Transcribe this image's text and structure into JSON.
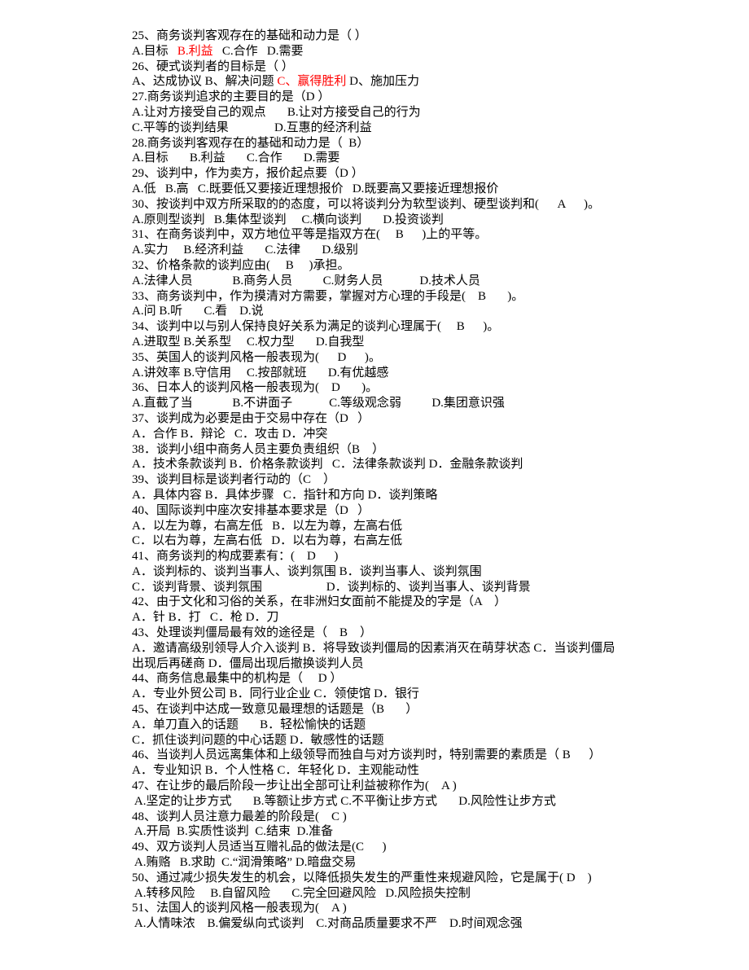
{
  "colors": {
    "text": "#000000",
    "highlight": "#ff0000"
  },
  "lines": [
    [
      {
        "t": "25、商务谈判客观存在的基础和动力是（ ）"
      }
    ],
    [
      {
        "t": "A.目标   "
      },
      {
        "t": "B.利益",
        "red": true
      },
      {
        "t": "   C.合作   D.需要"
      }
    ],
    [
      {
        "t": "26、硬式谈判者的目标是（ ）"
      }
    ],
    [
      {
        "t": "A、达成协议 B、解决问题 "
      },
      {
        "t": "C、赢得胜利",
        "red": true
      },
      {
        "t": " D、施加压力"
      }
    ],
    [
      {
        "t": "27.商务谈判追求的主要目的是（D ）"
      }
    ],
    [
      {
        "t": "A.让对方接受自己的观点       B.让对方接受自己的行为"
      }
    ],
    [
      {
        "t": "C.平等的谈判结果               D.互惠的经济利益"
      }
    ],
    [
      {
        "t": "28.商务谈判客观存在的基础和动力是（  B）"
      }
    ],
    [
      {
        "t": "A.目标       B.利益       C.合作       D.需要"
      }
    ],
    [
      {
        "t": "29、谈判中，作为卖方，报价起点要（D ）"
      }
    ],
    [
      {
        "t": "A.低   B.高   C.既要低又要接近理想报价   D.既要高又要接近理想报价"
      }
    ],
    [
      {
        "t": "30、按谈判中双方所采取的的态度，可以将谈判分为软型谈判、硬型谈判和(      A      )。"
      }
    ],
    [
      {
        "t": "A.原则型谈判   B.集体型谈判     C.横向谈判       D.投资谈判"
      }
    ],
    [
      {
        "t": "31、在商务谈判中，双方地位平等是指双方在(     B      )上的平等。"
      }
    ],
    [
      {
        "t": "A.实力     B.经济利益       C.法律       D.级别"
      }
    ],
    [
      {
        "t": "32、价格条款的谈判应由(     B     )承担。"
      }
    ],
    [
      {
        "t": "A.法律人员             B.商务人员          C.财务人员            D.技术人员"
      }
    ],
    [
      {
        "t": "33、商务谈判中，作为摸清对方需要，掌握对方心理的手段是(    B       )。"
      }
    ],
    [
      {
        "t": "A.问 B.听       C.看    D.说"
      }
    ],
    [
      {
        "t": "34、谈判中以与别人保持良好关系为满足的谈判心理属于(     B      )。"
      }
    ],
    [
      {
        "t": "A.进取型 B.关系型     C.权力型       D.自我型"
      }
    ],
    [
      {
        "t": "35、英国人的谈判风格一般表现为(      D      )。"
      }
    ],
    [
      {
        "t": "A.讲效率 B.守信用     C.按部就班       D.有优越感"
      }
    ],
    [
      {
        "t": "36、日本人的谈判风格一般表现为(    D       )。"
      }
    ],
    [
      {
        "t": "A.直截了当             B.不讲面子            C.等级观念弱          D.集团意识强"
      }
    ],
    [
      {
        "t": "37、谈判成为必要是由于交易中存在（D   ）"
      }
    ],
    [
      {
        "t": "A．合作 B．辩论   C．攻击 D．冲突"
      }
    ],
    [
      {
        "t": "38．谈判小组中商务人员主要负责组织（B    ）"
      }
    ],
    [
      {
        "t": "A．技术条款谈判 B．价格条款谈判   C．法律条款谈判 D．金融条款谈判"
      }
    ],
    [
      {
        "t": "39、谈判目标是谈判者行动的（C    ）"
      }
    ],
    [
      {
        "t": "A．具体内容 B．具体步骤   C．指针和方向 D．谈判策略"
      }
    ],
    [
      {
        "t": "40、国际谈判中座次安排基本要求是（D   ）"
      }
    ],
    [
      {
        "t": "A．以左为尊，右高左低   B．以左为尊，左高右低"
      }
    ],
    [
      {
        "t": "C．以右为尊，左高右低   D．以右为尊，右高左低"
      }
    ],
    [
      {
        "t": "41、商务谈判的构成要素有：(    D      )"
      }
    ],
    [
      {
        "t": "A．谈判标的、谈判当事人、谈判氛围 B．谈判当事人、谈判氛围"
      }
    ],
    [
      {
        "t": "C．谈判背景、谈判氛围                     D．谈判标的、谈判当事人、谈判背景"
      }
    ],
    [
      {
        "t": "42、由于文化和习俗的关系，在非洲妇女面前不能提及的字是（A    ）"
      }
    ],
    [
      {
        "t": "A．针 B．打   C．枪 D．刀"
      }
    ],
    [
      {
        "t": "43、处理谈判僵局最有效的途径是（    B    ）"
      }
    ],
    [
      {
        "t": "A．邀请高级别领导人介入谈判 B．将导致谈判僵局的因素消灭在萌芽状态 C．当谈判僵局"
      }
    ],
    [
      {
        "t": "出现后再磋商 D．僵局出现后撤换谈判人员"
      }
    ],
    [
      {
        "t": "44、商务信息最集中的机构是（     D ）"
      }
    ],
    [
      {
        "t": "A．专业外贸公司 B．同行业企业 C．领使馆 D．银行"
      }
    ],
    [
      {
        "t": "45、在谈判中达成一致意见最理想的话题是（B       ）"
      }
    ],
    [
      {
        "t": "A．单刀直入的话题       B．轻松愉快的话题"
      }
    ],
    [
      {
        "t": "C．抓住谈判问题的中心话题 D．敏感性的话题"
      }
    ],
    [
      {
        "t": "46、当谈判人员远离集体和上级领导而独自与对方谈判时，特别需要的素质是（ B      ）"
      }
    ],
    [
      {
        "t": "A．专业知识 B．个人性格 C．年轻化 D．主观能动性"
      }
    ],
    [
      {
        "t": "47、在让步的最后阶段一步让出全部可让利益被称作为(    A )"
      }
    ],
    [
      {
        "t": " A.坚定的让步方式       B.等额让步方式 C.不平衡让步方式       D.风险性让步方式"
      }
    ],
    [
      {
        "t": "48、谈判人员注意力最差的阶段是(    C )"
      }
    ],
    [
      {
        "t": " A.开局  B.实质性谈判  C.结束  D.准备"
      }
    ],
    [
      {
        "t": "49、双方谈判人员适当互赠礼品的做法是(C      )"
      }
    ],
    [
      {
        "t": " A.贿赂   B.求助  C.“润滑策略” D.暗盘交易"
      }
    ],
    [
      {
        "t": "50、通过减少损失发生的机会，以降低损失发生的严重性来规避风险，它是属于( D    )"
      }
    ],
    [
      {
        "t": " A.转移风险     B.自留风险       C.完全回避风险   D.风险损失控制"
      }
    ],
    [
      {
        "t": "51、法国人的谈判风格一般表现为(    A )"
      }
    ],
    [
      {
        "t": " A.人情味浓    B.偏爱纵向式谈判    C.对商品质量要求不严    D.时间观念强"
      }
    ]
  ]
}
